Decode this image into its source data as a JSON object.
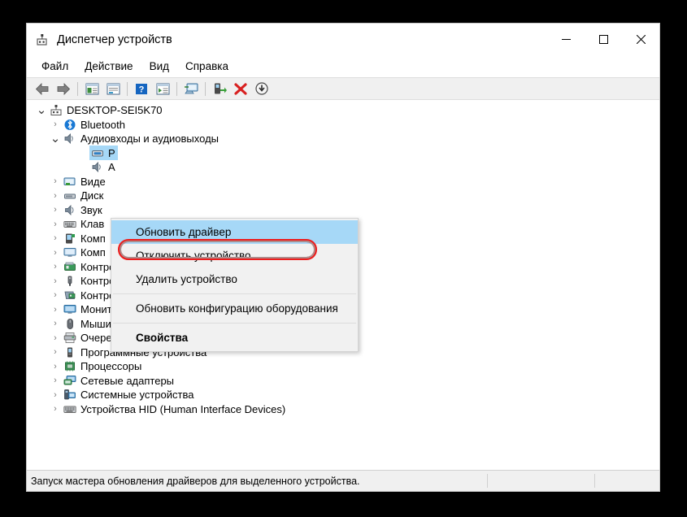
{
  "window": {
    "title": "Диспетчер устройств",
    "title_icon": "device-manager-icon",
    "controls": {
      "minimize": "—",
      "maximize": "□",
      "close": "✕"
    }
  },
  "menubar": {
    "items": [
      {
        "label": "Файл",
        "name": "menu-file"
      },
      {
        "label": "Действие",
        "name": "menu-action"
      },
      {
        "label": "Вид",
        "name": "menu-view"
      },
      {
        "label": "Справка",
        "name": "menu-help"
      }
    ]
  },
  "toolbar": {
    "buttons": [
      {
        "icon": "back-arrow-icon",
        "name": "toolbar-back"
      },
      {
        "icon": "forward-arrow-icon",
        "name": "toolbar-forward"
      },
      {
        "icon": "show-hide-console-tree-icon",
        "name": "toolbar-console-tree"
      },
      {
        "icon": "properties-window-icon",
        "name": "toolbar-properties"
      },
      {
        "icon": "help-icon",
        "name": "toolbar-help"
      },
      {
        "icon": "update-driver-window-icon",
        "name": "toolbar-update-driver"
      },
      {
        "icon": "scan-hardware-icon",
        "name": "toolbar-scan-hardware"
      },
      {
        "icon": "enable-device-icon",
        "name": "toolbar-enable-device"
      },
      {
        "icon": "uninstall-device-icon",
        "name": "toolbar-uninstall-device"
      },
      {
        "icon": "download-icon",
        "name": "toolbar-download"
      }
    ]
  },
  "tree": {
    "nodes": [
      {
        "label": "DESKTOP-SEI5K70",
        "level": 0,
        "state": "expanded",
        "icon": "computer-icon",
        "selected": false
      },
      {
        "label": "Bluetooth",
        "level": 1,
        "state": "collapsed",
        "icon": "bluetooth-icon",
        "selected": false
      },
      {
        "label": "Аудиовходы и аудиовыходы",
        "level": 1,
        "state": "expanded",
        "icon": "speaker-icon",
        "selected": false
      },
      {
        "label": "Р",
        "level": 2,
        "state": "leaf",
        "icon": "audio-device-icon",
        "selected": true
      },
      {
        "label": "А",
        "level": 2,
        "state": "leaf",
        "icon": "speaker-icon",
        "selected": false
      },
      {
        "label": "Виде",
        "level": 1,
        "state": "collapsed",
        "icon": "video-adapter-icon",
        "selected": false
      },
      {
        "label": "Диск",
        "level": 1,
        "state": "collapsed",
        "icon": "disk-drive-icon",
        "selected": false
      },
      {
        "label": "Звук",
        "level": 1,
        "state": "collapsed",
        "icon": "sound-icon",
        "selected": false
      },
      {
        "label": "Клав",
        "level": 1,
        "state": "collapsed",
        "icon": "keyboard-icon",
        "selected": false
      },
      {
        "label": "Комп",
        "level": 1,
        "state": "collapsed",
        "icon": "portable-device-icon",
        "selected": false
      },
      {
        "label": "Комп",
        "level": 1,
        "state": "collapsed",
        "icon": "computer-monitor-icon",
        "selected": false
      },
      {
        "label": "Контроллеры IDE ATA/ATAPI",
        "level": 1,
        "state": "collapsed",
        "icon": "ide-controller-icon",
        "selected": false
      },
      {
        "label": "Контроллеры USB",
        "level": 1,
        "state": "collapsed",
        "icon": "usb-icon",
        "selected": false
      },
      {
        "label": "Контроллеры запоминающих устройств",
        "level": 1,
        "state": "collapsed",
        "icon": "storage-controller-icon",
        "selected": false
      },
      {
        "label": "Мониторы",
        "level": 1,
        "state": "collapsed",
        "icon": "monitor-icon",
        "selected": false
      },
      {
        "label": "Мыши и иные указывающие устройства",
        "level": 1,
        "state": "collapsed",
        "icon": "mouse-icon",
        "selected": false
      },
      {
        "label": "Очереди печати",
        "level": 1,
        "state": "collapsed",
        "icon": "printer-icon",
        "selected": false
      },
      {
        "label": "Программные устройства",
        "level": 1,
        "state": "collapsed",
        "icon": "software-device-icon",
        "selected": false
      },
      {
        "label": "Процессоры",
        "level": 1,
        "state": "collapsed",
        "icon": "processor-icon",
        "selected": false
      },
      {
        "label": "Сетевые адаптеры",
        "level": 1,
        "state": "collapsed",
        "icon": "network-adapter-icon",
        "selected": false
      },
      {
        "label": "Системные устройства",
        "level": 1,
        "state": "collapsed",
        "icon": "system-device-icon",
        "selected": false
      },
      {
        "label": "Устройства HID (Human Interface Devices)",
        "level": 1,
        "state": "collapsed",
        "icon": "hid-icon",
        "selected": false
      }
    ]
  },
  "context_menu": {
    "items": [
      {
        "label": "Обновить драйвер",
        "name": "ctx-update-driver",
        "highlighted": true,
        "bold": false,
        "separator_after": false
      },
      {
        "label": "Отключить устройство",
        "name": "ctx-disable-device",
        "highlighted": false,
        "bold": false,
        "separator_after": false
      },
      {
        "label": "Удалить устройство",
        "name": "ctx-uninstall-device",
        "highlighted": false,
        "bold": false,
        "separator_after": true
      },
      {
        "label": "Обновить конфигурацию оборудования",
        "name": "ctx-scan-hardware-changes",
        "highlighted": false,
        "bold": false,
        "separator_after": true
      },
      {
        "label": "Свойства",
        "name": "ctx-properties",
        "highlighted": false,
        "bold": true,
        "separator_after": false
      }
    ]
  },
  "statusbar": {
    "text": "Запуск мастера обновления драйверов для выделенного устройства.",
    "pane2": "",
    "pane3": ""
  },
  "colors": {
    "selection": "#a6d8f7",
    "annotation": "#ee1c1c",
    "toolbar_bg": "#f0f0f0",
    "menu_bg": "#f1f1f1",
    "page_bg": "#000000"
  }
}
